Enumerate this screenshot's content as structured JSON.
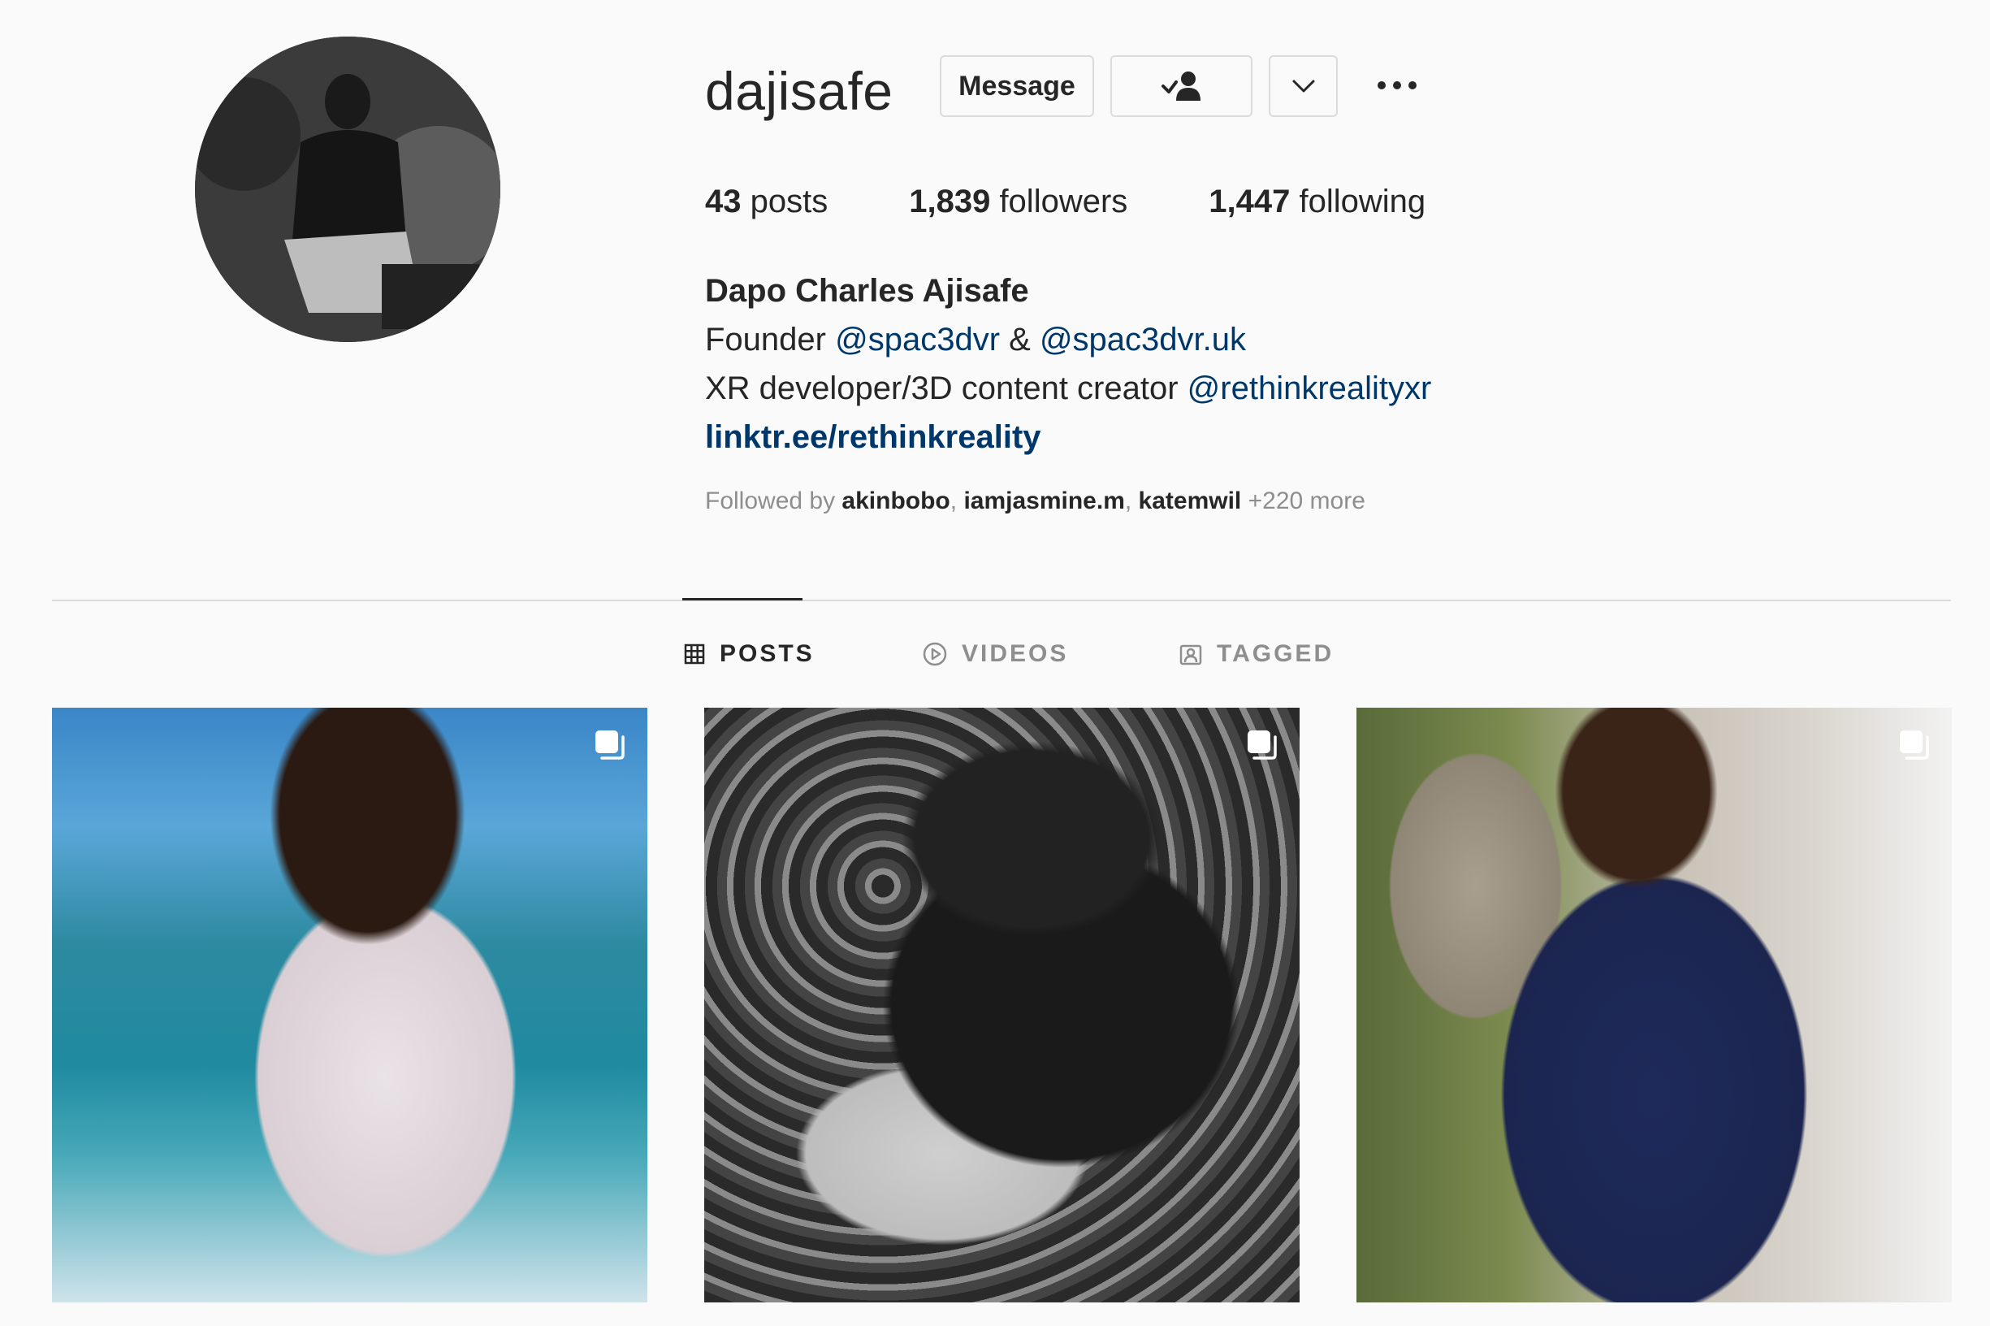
{
  "profile": {
    "username": "dajisafe",
    "display_name": "Dapo Charles Ajisafe",
    "bio": {
      "line1_prefix": "Founder ",
      "line1_mention1": "@spac3dvr",
      "line1_sep": " & ",
      "line1_mention2": "@spac3dvr.uk",
      "line2_prefix": "XR developer/3D content creator ",
      "line2_mention": "@rethinkrealityxr",
      "link": "linktr.ee/rethinkreality"
    }
  },
  "header": {
    "message_label": "Message",
    "follow_icon": "following-check-person-icon",
    "suggest_icon": "chevron-down-icon",
    "more_icon": "more-options-icon"
  },
  "stats": {
    "posts_count": "43",
    "posts_label": " posts",
    "followers_count": "1,839",
    "followers_label": " followers",
    "following_count": "1,447",
    "following_label": " following"
  },
  "followed_by": {
    "prefix": "Followed by ",
    "names": [
      "akinbobo",
      "iamjasmine.m",
      "katemwil"
    ],
    "suffix": " +220 more"
  },
  "tabs": [
    {
      "label": "POSTS",
      "icon": "grid-icon",
      "active": true
    },
    {
      "label": "VIDEOS",
      "icon": "play-circle-icon",
      "active": false
    },
    {
      "label": "TAGGED",
      "icon": "tagged-person-icon",
      "active": false
    }
  ],
  "posts": [
    {
      "type": "carousel",
      "icon": "multiple-photos-icon"
    },
    {
      "type": "carousel",
      "icon": "multiple-photos-icon"
    },
    {
      "type": "carousel",
      "icon": "multiple-photos-icon"
    }
  ],
  "colors": {
    "text": "#262626",
    "secondary": "#8e8e8e",
    "link": "#00376b",
    "border": "#dbdbdb",
    "background": "#fafafa"
  }
}
